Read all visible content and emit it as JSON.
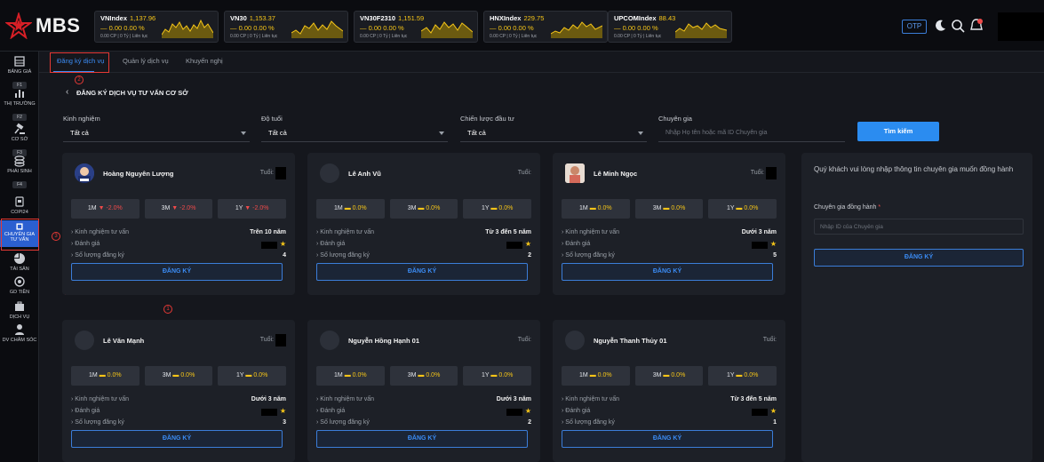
{
  "brand": {
    "name": "MBS"
  },
  "tickers": [
    {
      "name": "VNIndex",
      "value": "1,137.96",
      "change": "0.00 0.00 %",
      "sub": "0.00 CP | 0 Tỷ | Liên tục"
    },
    {
      "name": "VN30",
      "value": "1,153.37",
      "change": "0.00 0.00 %",
      "sub": "0.00 CP | 0 Tỷ | Liên tục"
    },
    {
      "name": "VN30F2310",
      "value": "1,151.59",
      "change": "0.00 0.00 %",
      "sub": "0.00 CP | 0 Tỷ | Liên tục"
    },
    {
      "name": "HNXIndex",
      "value": "229.75",
      "change": "0.00 0.00 %",
      "sub": "0.00 CP | 0 Tỷ | Liên tục"
    },
    {
      "name": "UPCOMIndex",
      "value": "88.43",
      "change": "0.00 0.00 %",
      "sub": "0.00 CP | 0 Tỷ | Liên tục"
    }
  ],
  "header": {
    "otp_label": "OTP"
  },
  "sidebar": [
    {
      "label": "BẢNG GIÁ",
      "key": "F1"
    },
    {
      "label": "THỊ TRƯỜNG",
      "key": "F2"
    },
    {
      "label": "CƠ SỞ",
      "key": "F3"
    },
    {
      "label": "PHÁI SINH",
      "key": "F4"
    },
    {
      "label": "COPI24"
    },
    {
      "label": "CHUYÊN GIA",
      "label2": "TƯ VẤN"
    },
    {
      "label": "TÀI SẢN"
    },
    {
      "label": "GD TIỀN"
    },
    {
      "label": "DỊCH VỤ"
    },
    {
      "label": "DV CHĂM SÓC"
    }
  ],
  "tabs": [
    "Đăng ký dịch vụ",
    "Quản lý dịch vụ",
    "Khuyến nghị"
  ],
  "annotations": [
    "2",
    "3",
    "1"
  ],
  "page": {
    "back": "‹",
    "title": "ĐĂNG KÝ DỊCH VỤ TƯ VẤN CƠ SỞ"
  },
  "filters": {
    "experience": {
      "label": "Kinh nghiệm",
      "value": "Tất cả"
    },
    "age": {
      "label": "Độ tuổi",
      "value": "Tất cả"
    },
    "strategy": {
      "label": "Chiến lược đầu tư",
      "value": "Tất cả"
    },
    "expert": {
      "label": "Chuyên gia",
      "placeholder": "Nhập Họ tên hoặc mã ID Chuyên gia"
    },
    "search_label": "Tìm kiếm"
  },
  "card_labels": {
    "age": "Tuổi:",
    "experience": "Kinh nghiệm tư vấn",
    "rating": "Đánh giá",
    "registrations": "Số lượng đăng ký",
    "register": "ĐĂNG KÝ",
    "p1m": "1M",
    "p3m": "3M",
    "p1y": "1Y"
  },
  "experts": [
    {
      "name": "Hoàng Nguyên Lượng",
      "m1": "-2.0%",
      "m3": "-2.0%",
      "y1": "-2.0%",
      "neg": true,
      "experience": "Trên 10 năm",
      "registrations": "4"
    },
    {
      "name": "Lê Anh Vũ",
      "m1": "0.0%",
      "m3": "0.0%",
      "y1": "0.0%",
      "neg": false,
      "experience": "Từ 3 đến 5 năm",
      "registrations": "2"
    },
    {
      "name": "Lê Minh Ngọc",
      "m1": "0.0%",
      "m3": "0.0%",
      "y1": "0.0%",
      "neg": false,
      "experience": "Dưới 3 năm",
      "registrations": "5"
    },
    {
      "name": "Lê Văn Mạnh",
      "m1": "0.0%",
      "m3": "0.0%",
      "y1": "0.0%",
      "neg": false,
      "experience": "Dưới 3 năm",
      "registrations": "3"
    },
    {
      "name": "Nguyễn Hồng Hạnh 01",
      "m1": "0.0%",
      "m3": "0.0%",
      "y1": "0.0%",
      "neg": false,
      "experience": "Dưới 3 năm",
      "registrations": "2"
    },
    {
      "name": "Nguyễn Thanh Thủy 01",
      "m1": "0.0%",
      "m3": "0.0%",
      "y1": "0.0%",
      "neg": false,
      "experience": "Từ 3 đến 5 năm",
      "registrations": "1"
    }
  ],
  "panel": {
    "message": "Quý khách vui lòng nhập thông tin chuyên gia muốn đồng hành",
    "field_label": "Chuyên gia đồng hành",
    "required_mark": "*",
    "placeholder": "Nhập ID của Chuyên gia",
    "button": "ĐĂNG KÝ"
  },
  "colors": {
    "accent": "#2b8cf0",
    "up_neutral": "#f5c518",
    "down": "#ef4a4a",
    "annotation": "#e53935"
  }
}
